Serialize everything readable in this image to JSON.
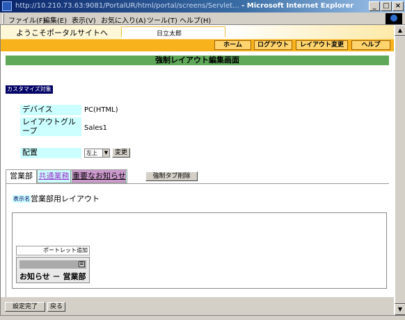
{
  "window": {
    "title_url": "http://10.210.73.63:9081/PortalUR/html/portal/screens/Servlet...",
    "title_app": " - Microsoft Internet Explorer",
    "minimize": "_",
    "maximize": "□",
    "close": "×"
  },
  "menu": {
    "items": [
      "ファイル(F)",
      "編集(E)",
      "表示(V)",
      "お気に入り(A)",
      "ツール(T)",
      "ヘルプ(H)"
    ]
  },
  "portal": {
    "portal_link": "ようこそポータルサイトへ",
    "user_name": "日立太郎",
    "nav": [
      "ホーム",
      "ログアウト",
      "レイアウト変更",
      "ヘルプ"
    ],
    "page_title": "強制レイアウト編集画面",
    "customize_target": "カスタマイズ対象",
    "device_label": "デバイス",
    "device_value": "PC(HTML)",
    "layout_group_label": "レイアウトグループ",
    "layout_group_value": "Sales1",
    "placement_label": "配置",
    "placement_value": "左上",
    "change_button": "変更",
    "tabs": [
      "営業部",
      "共通業務",
      "重要なお知らせ"
    ],
    "delete_tab_button": "強制タブ削除",
    "display_name_badge": "表示名",
    "display_name_value": "営業部用レイアウト",
    "add_portlet": "ポートレット追加",
    "portlet_close": "⊠",
    "portlet_title": "お知らせ － 営業部",
    "done_button": "設定完了",
    "back_button": "戻る"
  },
  "colors": {
    "accent_orange": "#f7b21c",
    "title_green": "#5fa85a",
    "label_cyan": "#ccffff",
    "badge_navy": "#000066"
  }
}
